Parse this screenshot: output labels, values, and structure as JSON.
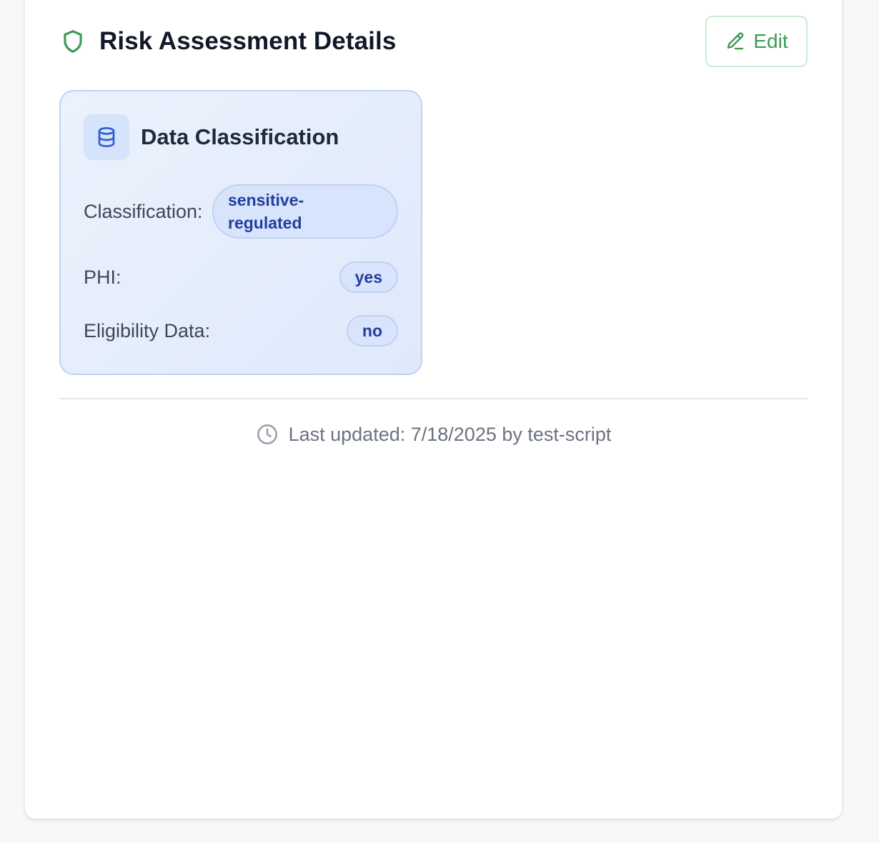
{
  "header": {
    "title": "Risk Assessment Details",
    "edit_label": "Edit",
    "icon": "shield-icon"
  },
  "card": {
    "title": "Data Classification",
    "icon": "database-icon",
    "rows": [
      {
        "label": "Classification:",
        "value": "sensitive-regulated"
      },
      {
        "label": "PHI:",
        "value": "yes"
      },
      {
        "label": "Eligibility Data:",
        "value": "no"
      }
    ]
  },
  "footer": {
    "text": "Last updated: 7/18/2025 by test-script",
    "icon": "clock-icon"
  },
  "colors": {
    "accent_green": "#3f9a55",
    "card_blue": "#e4edfc",
    "pill_text": "#243ea0"
  }
}
